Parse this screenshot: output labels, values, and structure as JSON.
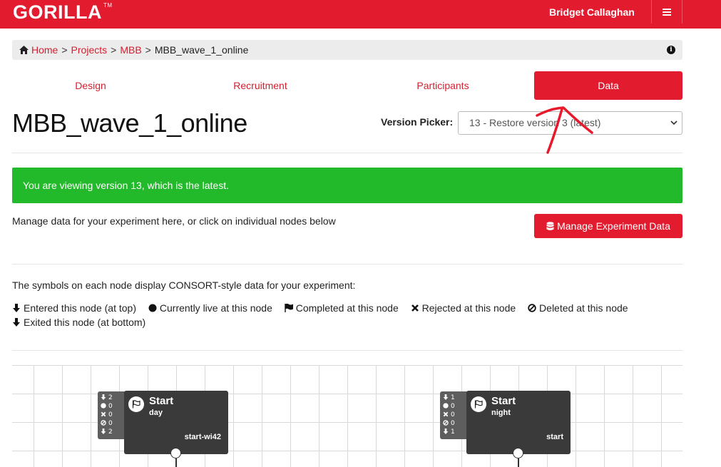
{
  "app": {
    "logo": "GORILLA",
    "trademark": "TM",
    "user_name": "Bridget Callaghan"
  },
  "breadcrumb": {
    "home": "Home",
    "projects": "Projects",
    "project": "MBB",
    "current": "MBB_wave_1_online",
    "separator": ">"
  },
  "tabs": [
    {
      "label": "Design",
      "active": false
    },
    {
      "label": "Recruitment",
      "active": false
    },
    {
      "label": "Participants",
      "active": false
    },
    {
      "label": "Data",
      "active": true
    }
  ],
  "page": {
    "title": "MBB_wave_1_online"
  },
  "version_picker": {
    "label": "Version Picker:",
    "selected": "13 - Restore version 3 (latest)"
  },
  "alert": {
    "text": "You are viewing version 13, which is the latest.",
    "color": "#22b92a"
  },
  "manage": {
    "description": "Manage data for your experiment here, or click on individual nodes below",
    "button_label": "Manage Experiment Data"
  },
  "consort": {
    "intro": "The symbols on each node display CONSORT-style data for your experiment:",
    "legend": [
      {
        "icon": "arrow-down-icon",
        "label": "Entered this node (at top)"
      },
      {
        "icon": "circle-icon",
        "label": "Currently live at this node"
      },
      {
        "icon": "flag-icon",
        "label": "Completed at this node"
      },
      {
        "icon": "x-icon",
        "label": "Rejected at this node"
      },
      {
        "icon": "ban-icon",
        "label": "Deleted at this node"
      },
      {
        "icon": "arrow-down-icon",
        "label": "Exited this node (at bottom)"
      }
    ]
  },
  "nodes": [
    {
      "title": "Start",
      "subtitle": "day",
      "id": "start-wi42",
      "entered": "2",
      "live": "0",
      "rejected": "0",
      "deleted": "0",
      "exited": "2"
    },
    {
      "title": "Start",
      "subtitle": "night",
      "id": "start",
      "entered": "1",
      "live": "0",
      "rejected": "0",
      "deleted": "0",
      "exited": "1"
    }
  ],
  "colors": {
    "brand": "#e31b2f",
    "link": "#d31f2f",
    "node": "#3a3a3a",
    "annotation": "#e8192c"
  }
}
